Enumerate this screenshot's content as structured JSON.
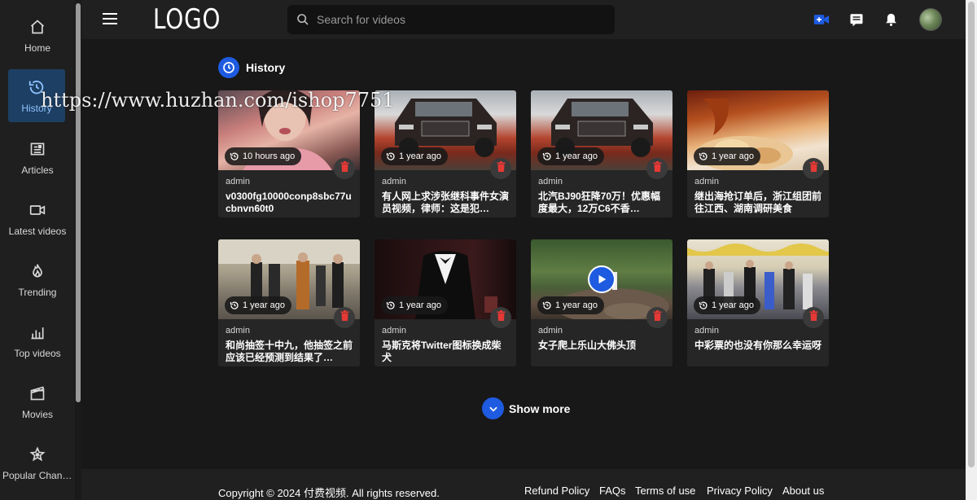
{
  "colors": {
    "accent": "#1e5be0",
    "background": "#181818",
    "sidebar": "#1f1f1f",
    "active_bg": "#1d3f63",
    "delete": "#e53935"
  },
  "sidebar": {
    "items": [
      {
        "label": "Home",
        "icon": "home-icon"
      },
      {
        "label": "History",
        "icon": "history-icon",
        "active": true
      },
      {
        "label": "Articles",
        "icon": "article-icon"
      },
      {
        "label": "Latest videos",
        "icon": "video-icon"
      },
      {
        "label": "Trending",
        "icon": "fire-icon"
      },
      {
        "label": "Top videos",
        "icon": "bar-chart-icon"
      },
      {
        "label": "Movies",
        "icon": "movie-icon"
      },
      {
        "label": "Popular Channels",
        "icon": "star-icon"
      }
    ]
  },
  "header": {
    "logo": "LOGO",
    "search_placeholder": "Search for videos",
    "icons": [
      "upload-video-icon",
      "messages-icon",
      "bell-icon",
      "avatar"
    ]
  },
  "main": {
    "section_title": "History",
    "videos": [
      {
        "time": "10 hours ago",
        "author": "admin",
        "title": "v0300fg10000conp8sbc77ucbnvn60t0"
      },
      {
        "time": "1 year ago",
        "author": "admin",
        "title": "有人网上求涉张继科事件女演员视频，律师：这是犯…"
      },
      {
        "time": "1 year ago",
        "author": "admin",
        "title": "北汽BJ90狂降70万！优惠幅度最大，12万C6不香…"
      },
      {
        "time": "1 year ago",
        "author": "admin",
        "title": "继出海抢订单后，浙江组团前往江西、湖南调研美食"
      },
      {
        "time": "1 year ago",
        "author": "admin",
        "title": "和尚抽签十中九，他抽签之前应该已经预测到结果了…"
      },
      {
        "time": "1 year ago",
        "author": "admin",
        "title": "马斯克将Twitter图标换成柴犬"
      },
      {
        "time": "1 year ago",
        "author": "admin",
        "title": "女子爬上乐山大佛头顶"
      },
      {
        "time": "1 year ago",
        "author": "admin",
        "title": "中彩票的也没有你那么幸运呀"
      }
    ],
    "show_more": "Show more"
  },
  "watermark": "https://www.huzhan.com/ishop7751",
  "footer": {
    "copyright": "Copyright © 2024 付费视频. All rights reserved.",
    "links": [
      "Refund Policy",
      "FAQs",
      "Terms of use",
      "Privacy Policy",
      "About us"
    ]
  }
}
